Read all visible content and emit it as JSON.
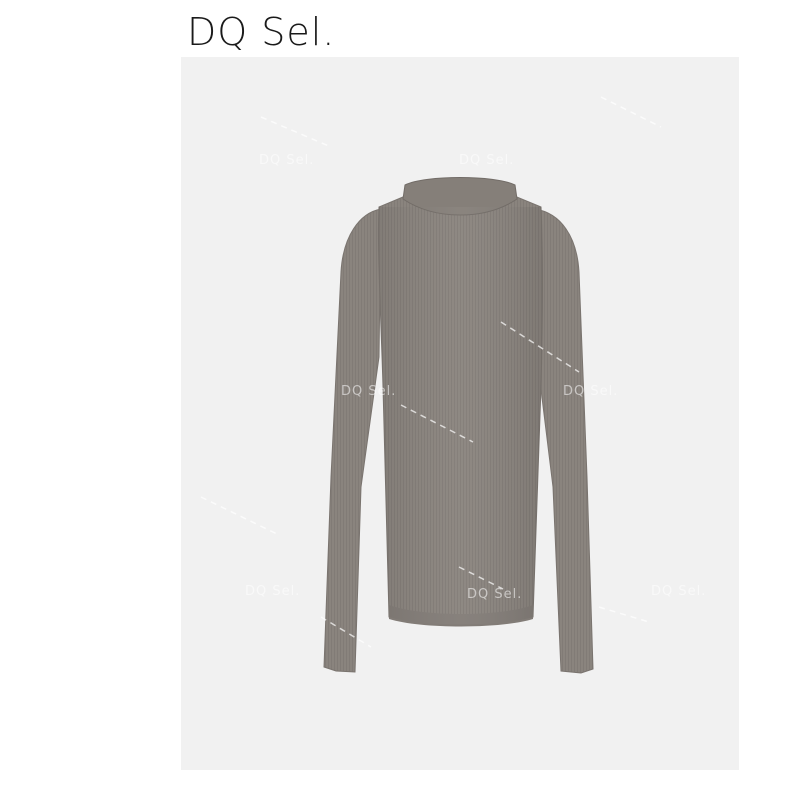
{
  "brand": {
    "name": "DQ Sel."
  },
  "photo": {
    "subject": "sweater-photo",
    "background_color": "#f1f1f1",
    "garment_color": "#8a847e",
    "watermark_text": "DQ Sel."
  }
}
